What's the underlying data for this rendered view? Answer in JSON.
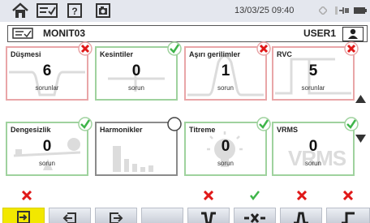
{
  "toolbar": {
    "datetime": "13/03/25 09:40",
    "icons": [
      "home-icon",
      "list-check-icon",
      "help-icon",
      "camera-icon",
      "sync-icon",
      "network-icon",
      "battery-icon"
    ]
  },
  "header": {
    "title": "MONIT03",
    "user": "USER1"
  },
  "tiles": [
    {
      "name": "Düşmesi",
      "count": "6",
      "unit": "sorunlar",
      "status": "error"
    },
    {
      "name": "Kesintiler",
      "count": "0",
      "unit": "sorun",
      "status": "ok"
    },
    {
      "name": "Aşırı gerilimler",
      "count": "1",
      "unit": "sorun",
      "status": "error"
    },
    {
      "name": "RVC",
      "count": "5",
      "unit": "sorunlar",
      "status": "error"
    },
    {
      "name": "Dengesizlik",
      "count": "0",
      "unit": "sorun",
      "status": "ok"
    },
    {
      "name": "Harmonikler",
      "count": "",
      "unit": "",
      "status": "none"
    },
    {
      "name": "Titreme",
      "count": "0",
      "unit": "sorun",
      "status": "ok"
    },
    {
      "name": "VRMS",
      "count": "0",
      "unit": "sorun",
      "status": "ok",
      "art_text": "VRMS"
    }
  ],
  "bottom_buttons": [
    {
      "icon": "load-file-icon",
      "status": "error"
    },
    {
      "icon": "import-icon",
      "status": ""
    },
    {
      "icon": "export-icon",
      "status": ""
    },
    {
      "icon": "blank-icon",
      "status": ""
    },
    {
      "icon": "dip-icon",
      "status": "error"
    },
    {
      "icon": "interruption-icon",
      "status": "ok"
    },
    {
      "icon": "swell-icon",
      "status": "error"
    },
    {
      "icon": "rvc-icon",
      "status": "error"
    }
  ],
  "colors": {
    "error": "#e01818",
    "ok": "#3fb54a",
    "error_border": "#e9a6a8",
    "ok_border": "#9fd29e",
    "active_button": "#f2e800"
  }
}
